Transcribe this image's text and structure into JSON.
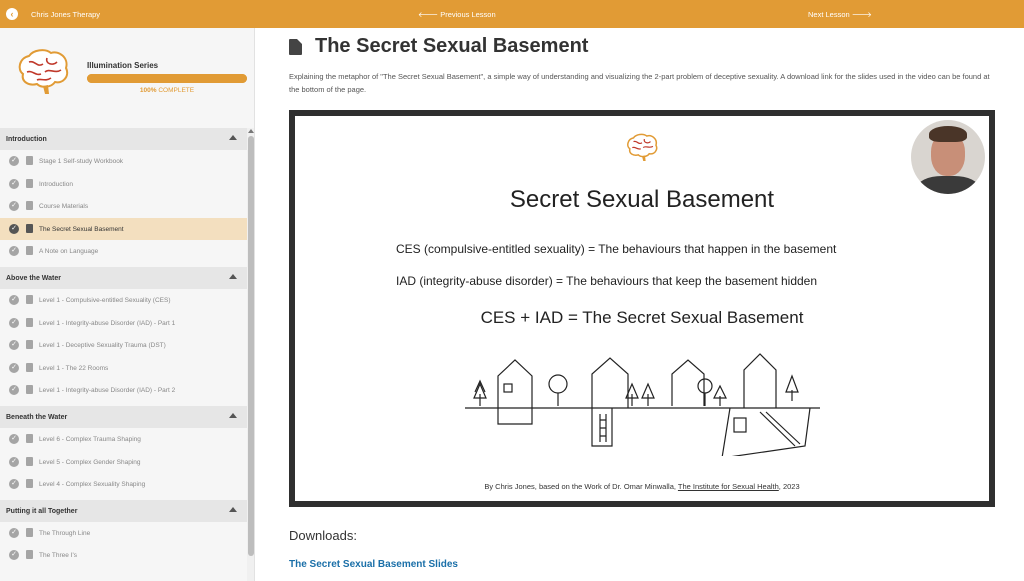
{
  "topbar": {
    "site_title": "Chris Jones Therapy",
    "prev_label": "Previous Lesson",
    "next_label": "Next Lesson"
  },
  "course": {
    "title": "Illumination Series",
    "progress_percent": "100%",
    "progress_suffix": "COMPLETE",
    "progress_value": 1.0
  },
  "sections": [
    {
      "title": "Introduction",
      "items": [
        {
          "label": "Stage 1 Self-study Workbook"
        },
        {
          "label": "Introduction"
        },
        {
          "label": "Course Materials"
        },
        {
          "label": "The Secret Sexual Basement",
          "active": true
        },
        {
          "label": "A Note on Language"
        }
      ]
    },
    {
      "title": "Above the Water",
      "items": [
        {
          "label": "Level 1 - Compulsive-entitled Sexuality (CES)"
        },
        {
          "label": "Level 1 - Integrity-abuse Disorder (IAD) - Part 1"
        },
        {
          "label": "Level 1 - Deceptive Sexuality Trauma (DST)"
        },
        {
          "label": "Level 1 - The 22 Rooms"
        },
        {
          "label": "Level 1 - Integrity-abuse Disorder (IAD) - Part 2"
        }
      ]
    },
    {
      "title": "Beneath the Water",
      "items": [
        {
          "label": "Level 6 - Complex Trauma Shaping"
        },
        {
          "label": "Level 5 - Complex Gender Shaping"
        },
        {
          "label": "Level 4 - Complex Sexuality Shaping"
        }
      ]
    },
    {
      "title": "Putting it all Together",
      "items": [
        {
          "label": "The Through Line"
        },
        {
          "label": "The Three I's"
        }
      ]
    }
  ],
  "lesson": {
    "title": "The Secret Sexual Basement",
    "description": "Explaining the metaphor of \"The Secret Sexual Basement\", a simple way of understanding and visualizing the 2-part problem of deceptive sexuality. A download link for the slides used in the video can be found at the bottom of the page."
  },
  "slide": {
    "title": "Secret Sexual Basement",
    "line1": "CES (compulsive-entitled sexuality) = The behaviours that happen in the basement",
    "line2": "IAD (integrity-abuse disorder) = The behaviours that keep the basement hidden",
    "line3": "CES + IAD = The Secret Sexual Basement",
    "credit_prefix": "By Chris Jones, based on the Work of Dr. Omar Minwalla,",
    "credit_link": "The Institute for Sexual Health",
    "credit_suffix": ", 2023"
  },
  "downloads": {
    "heading": "Downloads:",
    "link_label": "The Secret Sexual Basement Slides"
  },
  "colors": {
    "accent": "#e19b35",
    "active_item_bg": "#f3dfbf",
    "link": "#1a6fa8"
  }
}
